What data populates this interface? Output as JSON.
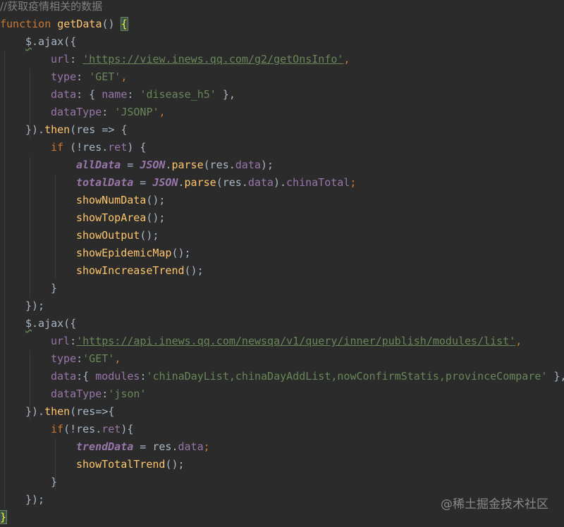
{
  "lines": [
    {
      "indent": 0,
      "tokens": [
        [
          "//获取疫情相关的数据",
          "comment"
        ]
      ]
    },
    {
      "indent": 0,
      "tokens": [
        [
          "function",
          "kw"
        ],
        [
          " ",
          "plain"
        ],
        [
          "getData",
          "fn"
        ],
        [
          "() ",
          "plain"
        ],
        [
          "{",
          "brace"
        ]
      ]
    },
    {
      "indent": 1,
      "tokens": [
        [
          "$",
          "sq"
        ],
        [
          ".ajax({",
          "plain"
        ]
      ]
    },
    {
      "indent": 2,
      "tokens": [
        [
          "url",
          "key"
        ],
        [
          ": ",
          "plain"
        ],
        [
          "'https://view.inews.qq.com/g2/getOnsInfo'",
          "url"
        ],
        [
          ",",
          "punct"
        ]
      ]
    },
    {
      "indent": 2,
      "tokens": [
        [
          "type",
          "key"
        ],
        [
          ": ",
          "plain"
        ],
        [
          "'GET'",
          "str"
        ],
        [
          ",",
          "punct"
        ]
      ]
    },
    {
      "indent": 2,
      "tokens": [
        [
          "data",
          "key"
        ],
        [
          ": { ",
          "plain"
        ],
        [
          "name",
          "key"
        ],
        [
          ": ",
          "plain"
        ],
        [
          "'disease_h5'",
          "str"
        ],
        [
          " },",
          "plain"
        ]
      ]
    },
    {
      "indent": 2,
      "tokens": [
        [
          "dataType",
          "key"
        ],
        [
          ": ",
          "plain"
        ],
        [
          "'JSONP'",
          "str"
        ],
        [
          ",",
          "punct"
        ]
      ]
    },
    {
      "indent": 1,
      "tokens": [
        [
          "}).",
          "plain"
        ],
        [
          "then",
          "call"
        ],
        [
          "(res => {",
          "plain"
        ]
      ]
    },
    {
      "indent": 2,
      "tokens": [
        [
          "if",
          "kw"
        ],
        [
          " (!res.",
          "plain"
        ],
        [
          "ret",
          "var2"
        ],
        [
          ") {",
          "plain"
        ]
      ]
    },
    {
      "indent": 3,
      "tokens": [
        [
          "allData",
          "var"
        ],
        [
          " = ",
          "plain"
        ],
        [
          "JSON",
          "json"
        ],
        [
          ".",
          "plain"
        ],
        [
          "parse",
          "call"
        ],
        [
          "(res.",
          "plain"
        ],
        [
          "data",
          "var2"
        ],
        [
          ");",
          "plain"
        ]
      ]
    },
    {
      "indent": 3,
      "tokens": [
        [
          "totalData",
          "var"
        ],
        [
          " = ",
          "plain"
        ],
        [
          "JSON",
          "json"
        ],
        [
          ".",
          "plain"
        ],
        [
          "parse",
          "call"
        ],
        [
          "(res.",
          "plain"
        ],
        [
          "data",
          "var2"
        ],
        [
          ").",
          "plain"
        ],
        [
          "chinaTotal",
          "var2"
        ],
        [
          ";",
          "punct"
        ]
      ]
    },
    {
      "indent": 3,
      "tokens": [
        [
          "showNumData",
          "call"
        ],
        [
          "();",
          "plain"
        ]
      ]
    },
    {
      "indent": 3,
      "tokens": [
        [
          "showTopArea",
          "call"
        ],
        [
          "();",
          "plain"
        ]
      ]
    },
    {
      "indent": 3,
      "tokens": [
        [
          "showOutput",
          "call"
        ],
        [
          "();",
          "plain"
        ]
      ]
    },
    {
      "indent": 3,
      "tokens": [
        [
          "showEpidemicMap",
          "call"
        ],
        [
          "();",
          "plain"
        ]
      ]
    },
    {
      "indent": 3,
      "tokens": [
        [
          "showIncreaseTrend",
          "call"
        ],
        [
          "();",
          "plain"
        ]
      ]
    },
    {
      "indent": 2,
      "tokens": [
        [
          "}",
          "plain"
        ]
      ]
    },
    {
      "indent": 1,
      "tokens": [
        [
          "});",
          "plain"
        ]
      ]
    },
    {
      "indent": 1,
      "tokens": [
        [
          "$",
          "sq"
        ],
        [
          ".ajax({",
          "plain"
        ]
      ]
    },
    {
      "indent": 2,
      "tokens": [
        [
          "url",
          "key"
        ],
        [
          ":",
          "plain"
        ],
        [
          "'https://api.inews.qq.com/newsqa/v1/query/inner/publish/modules/list'",
          "url"
        ],
        [
          ",",
          "punct"
        ]
      ]
    },
    {
      "indent": 2,
      "tokens": [
        [
          "type",
          "key"
        ],
        [
          ":",
          "plain"
        ],
        [
          "'GET'",
          "str"
        ],
        [
          ",",
          "punct"
        ]
      ]
    },
    {
      "indent": 2,
      "tokens": [
        [
          "data",
          "key"
        ],
        [
          ":{ ",
          "plain"
        ],
        [
          "modules",
          "key"
        ],
        [
          ":",
          "plain"
        ],
        [
          "'chinaDayList,chinaDayAddList,nowConfirmStatis,provinceCompare'",
          "str"
        ],
        [
          " },",
          "plain"
        ]
      ]
    },
    {
      "indent": 2,
      "tokens": [
        [
          "dataType",
          "key"
        ],
        [
          ":",
          "plain"
        ],
        [
          "'json'",
          "str"
        ]
      ]
    },
    {
      "indent": 1,
      "tokens": [
        [
          "}).",
          "plain"
        ],
        [
          "then",
          "call"
        ],
        [
          "(res=>{",
          "plain"
        ]
      ]
    },
    {
      "indent": 2,
      "tokens": [
        [
          "if",
          "kw"
        ],
        [
          "(!res.",
          "plain"
        ],
        [
          "ret",
          "var2"
        ],
        [
          "){",
          "plain"
        ]
      ]
    },
    {
      "indent": 3,
      "tokens": [
        [
          "trendData",
          "var"
        ],
        [
          " = res.",
          "plain"
        ],
        [
          "data",
          "var2"
        ],
        [
          ";",
          "punct"
        ]
      ]
    },
    {
      "indent": 3,
      "tokens": [
        [
          "showTotalTrend",
          "call"
        ],
        [
          "();",
          "plain"
        ]
      ]
    },
    {
      "indent": 2,
      "tokens": [
        [
          "}",
          "plain"
        ]
      ]
    },
    {
      "indent": 1,
      "tokens": [
        [
          "});",
          "plain"
        ]
      ]
    },
    {
      "indent": 0,
      "tokens": [
        [
          "}",
          "brace"
        ]
      ]
    }
  ],
  "watermark": "@稀土掘金技术社区",
  "colors": {
    "background": "#2b2b2b",
    "comment": "#808080",
    "keyword": "#cc7832",
    "function": "#ffc66d",
    "property": "#9876aa",
    "string": "#6a8759",
    "text": "#a9b7c6"
  }
}
